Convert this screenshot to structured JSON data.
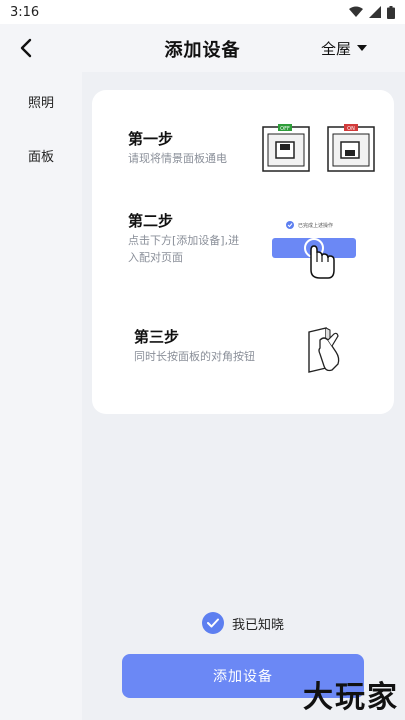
{
  "status": {
    "time": "3:16"
  },
  "header": {
    "title": "添加设备",
    "room": "全屋"
  },
  "sidebar": {
    "items": [
      {
        "label": "照明"
      },
      {
        "label": "面板"
      }
    ]
  },
  "steps": [
    {
      "title": "第一步",
      "desc": "请现将情景面板通电",
      "switch_off": "OFF",
      "switch_on": "ON"
    },
    {
      "title": "第二步",
      "desc_line1": "点击下方[添加设备],进",
      "desc_line2": "入配对页面",
      "mini_label": "已完成上述操作"
    },
    {
      "title": "第三步",
      "desc": "同时长按面板的对角按钮"
    }
  ],
  "confirm": {
    "label": "我已知晓"
  },
  "action": {
    "label": "添加设备"
  },
  "watermark": "大玩家",
  "colors": {
    "accent": "#6b88f5",
    "check": "#5d7ff0",
    "off": "#2e9d3a",
    "on": "#d23b3b"
  }
}
